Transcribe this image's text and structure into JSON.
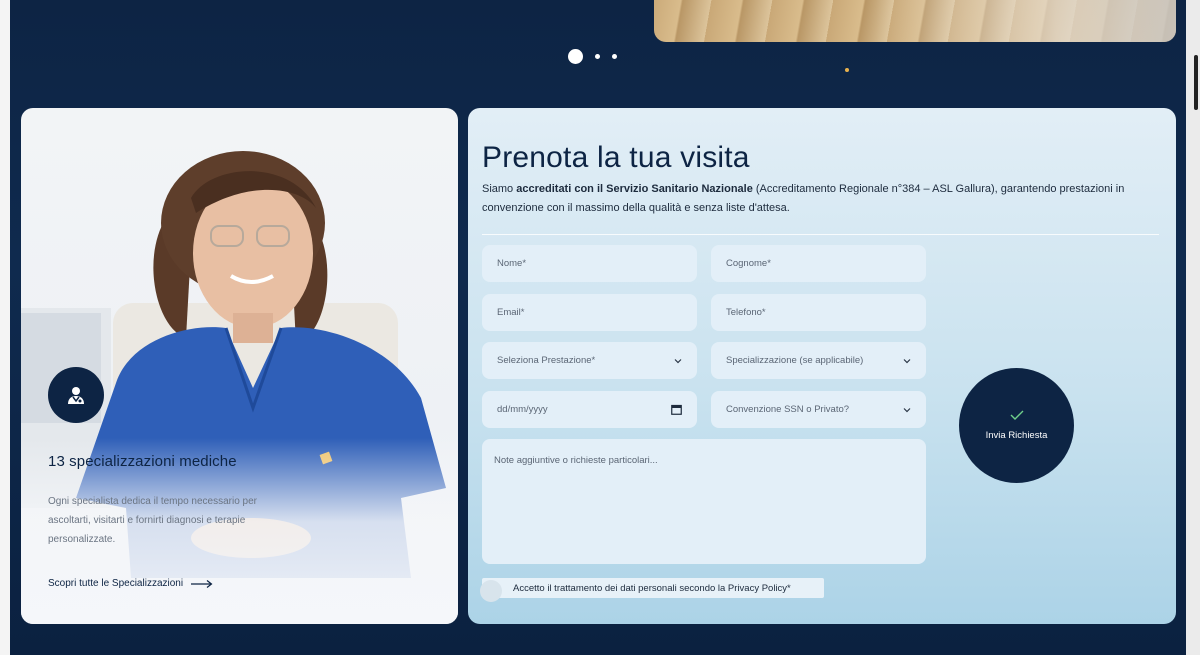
{
  "colors": {
    "navy": "#0d2444",
    "gold_dot": "#e8b14d",
    "field_bg": "#e3eff8",
    "check_color": "#6fcf8b"
  },
  "carousel": {
    "slides": 3,
    "active_index": 0
  },
  "specialties_card": {
    "icon": "doctor-icon",
    "title": "13 specializzazioni mediche",
    "description": "Ogni specialista dedica il tempo necessario per ascoltarti, visitarti e fornirti diagnosi e terapie personalizzate.",
    "link_label": "Scopri tutte le Specializzazioni",
    "link_icon": "arrow-right-icon"
  },
  "booking_form": {
    "title": "Prenota la tua visita",
    "intro_prefix": "Siamo ",
    "intro_bold": "accreditati con il Servizio Sanitario Nazionale",
    "intro_suffix": " (Accreditamento Regionale n°384 – ASL Gallura), garantendo prestazioni in convenzione con il massimo della qualità e senza liste d'attesa.",
    "fields": {
      "nome": "Nome*",
      "cognome": "Cognome*",
      "email": "Email*",
      "telefono": "Telefono*",
      "prestazione": "Seleziona Prestazione*",
      "specializzazione": "Specializzazione (se applicabile)",
      "data": "dd/mm/yyyy",
      "convenzione": "Convenzione SSN o Privato?",
      "note": "Note aggiuntive o richieste particolari..."
    },
    "consent_label": "Accetto il trattamento dei dati personali secondo la Privacy Policy*",
    "submit_label": "Invia Richiesta",
    "submit_icon": "check-icon"
  }
}
